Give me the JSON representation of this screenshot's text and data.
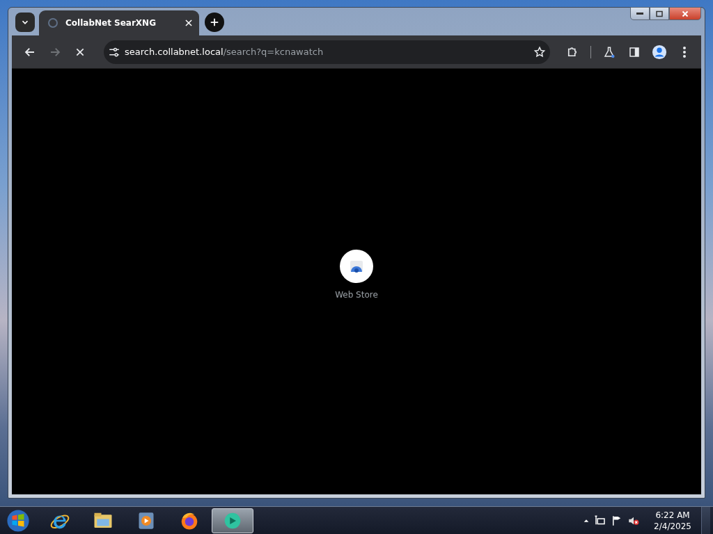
{
  "tabs": [
    {
      "title": "CollabNet SearXNG",
      "selected": true
    }
  ],
  "address": {
    "host": "search.collabnet.local",
    "path": "/search?q=kcnawatch"
  },
  "toolbar": {
    "loading": true
  },
  "page": {
    "app_label": "Web Store"
  },
  "taskbar": {
    "items": [
      {
        "kind": "ie",
        "selected": false
      },
      {
        "kind": "folder",
        "selected": false
      },
      {
        "kind": "media",
        "selected": false
      },
      {
        "kind": "firefox",
        "selected": false
      },
      {
        "kind": "chat",
        "selected": true
      }
    ]
  },
  "clock": {
    "time": "6:22 AM",
    "date": "2/4/2025"
  }
}
